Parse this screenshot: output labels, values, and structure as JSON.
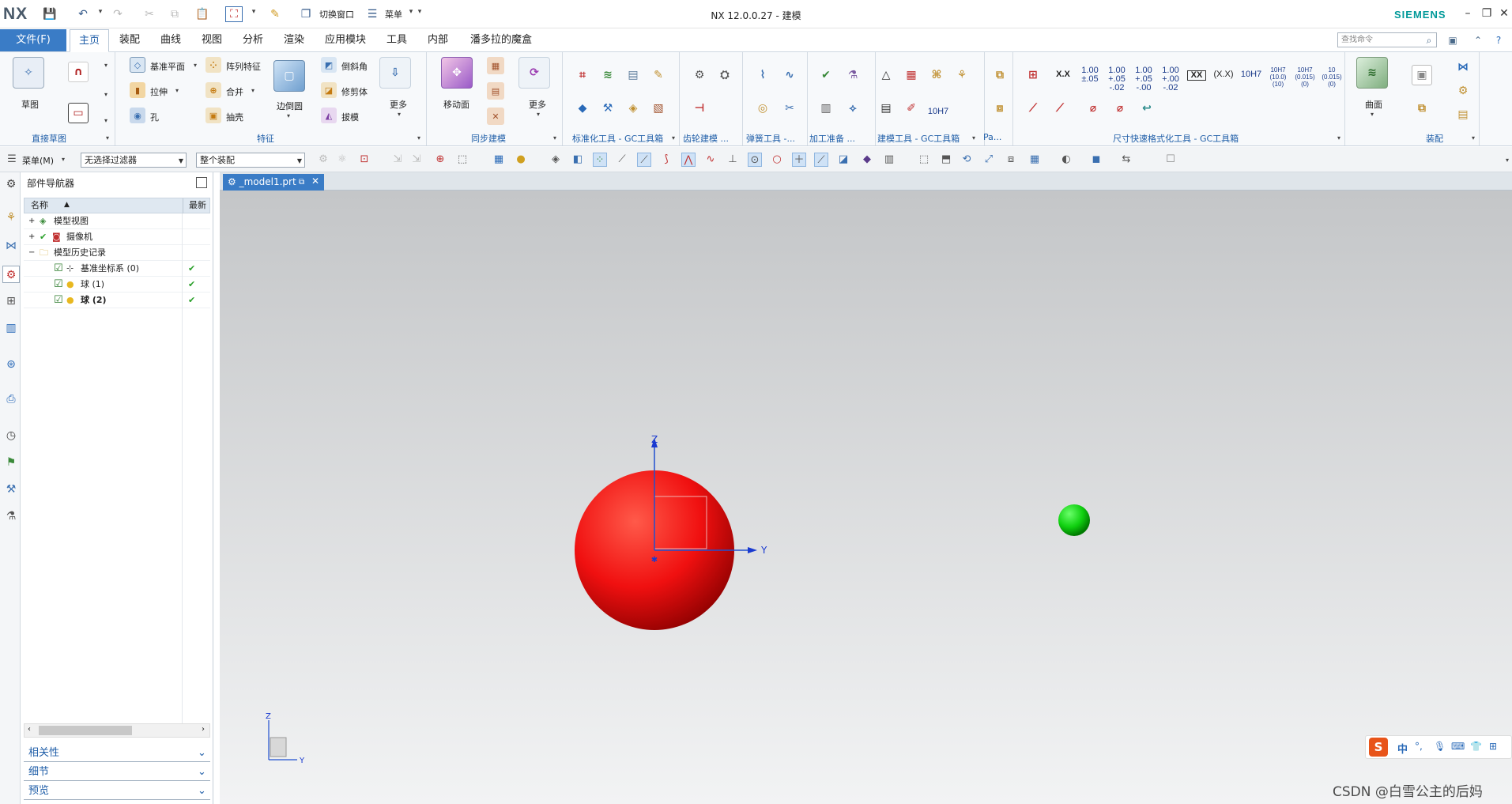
{
  "app": {
    "logo": "NX",
    "window_title": "NX 12.0.0.27 - 建模",
    "brand": "SIEMENS"
  },
  "quick_access": {
    "switch_window": "切换窗口",
    "menu": "菜单"
  },
  "menu_tabs": [
    "文件(F)",
    "主页",
    "装配",
    "曲线",
    "视图",
    "分析",
    "渲染",
    "应用模块",
    "工具",
    "内部",
    "潘多拉的魔盒"
  ],
  "active_tab": "主页",
  "command_search_placeholder": "查找命令",
  "ribbon": {
    "sketch": {
      "label": "草图",
      "group": "直接草图"
    },
    "feature": {
      "items": [
        "基准平面",
        "拉伸",
        "孔",
        "阵列特征",
        "合并",
        "抽壳",
        "边倒圆",
        "倒斜角",
        "修剪体",
        "拔模",
        "更多"
      ],
      "group": "特征"
    },
    "sync": {
      "items": [
        "移动面",
        "更多"
      ],
      "group": "同步建模"
    },
    "groups": [
      "标准化工具 - GC工具箱",
      "齿轮建模 ...",
      "弹簧工具 -...",
      "加工准备 ...",
      "建模工具 - GC工具箱",
      "Pa...",
      "尺寸快速格式化工具 - GC工具箱",
      "装配"
    ],
    "dim_items": [
      "X.X",
      "1.00 ±.05",
      "1.00 +.05 -.02",
      "1.00 +.05 -.00",
      "1.00 +.00 -.02",
      "XX",
      "(X.X)",
      "10H7",
      "10H7 (10.0) (10)",
      "10H7 (0.015) (0)",
      "10 (0.015) (0)"
    ],
    "tool_10h7": "10H7",
    "surface": {
      "label": "曲面"
    }
  },
  "toolbar2": {
    "menu_button": "菜单(M)",
    "filter": "无选择过滤器",
    "scope": "整个装配"
  },
  "navigator": {
    "title": "部件导航器",
    "col_name": "名称",
    "col_latest": "最新",
    "rows": [
      {
        "label": "模型视图",
        "level": 0,
        "expander": "+",
        "check": "",
        "latest": ""
      },
      {
        "label": "摄像机",
        "level": 0,
        "expander": "+",
        "check": "✔",
        "latest": ""
      },
      {
        "label": "模型历史记录",
        "level": 0,
        "expander": "−",
        "check": "",
        "latest": ""
      },
      {
        "label": "基准坐标系 (0)",
        "level": 1,
        "expander": "",
        "check": "☑",
        "latest": "✔"
      },
      {
        "label": "球 (1)",
        "level": 1,
        "expander": "",
        "check": "☑",
        "latest": "✔"
      },
      {
        "label": "球 (2)",
        "level": 1,
        "expander": "",
        "check": "☑",
        "latest": "✔"
      }
    ],
    "panels": [
      "相关性",
      "细节",
      "预览"
    ]
  },
  "document_tab": "_model1.prt",
  "viewport": {
    "axis_z": "Z",
    "axis_y": "Y",
    "triad_z": "Z",
    "triad_y": "Y",
    "sphere_big_color": "#ff0000",
    "sphere_small_color": "#00cc00"
  },
  "ime_bar": {
    "label": "中"
  },
  "watermark": "CSDN @白雪公主的后妈"
}
